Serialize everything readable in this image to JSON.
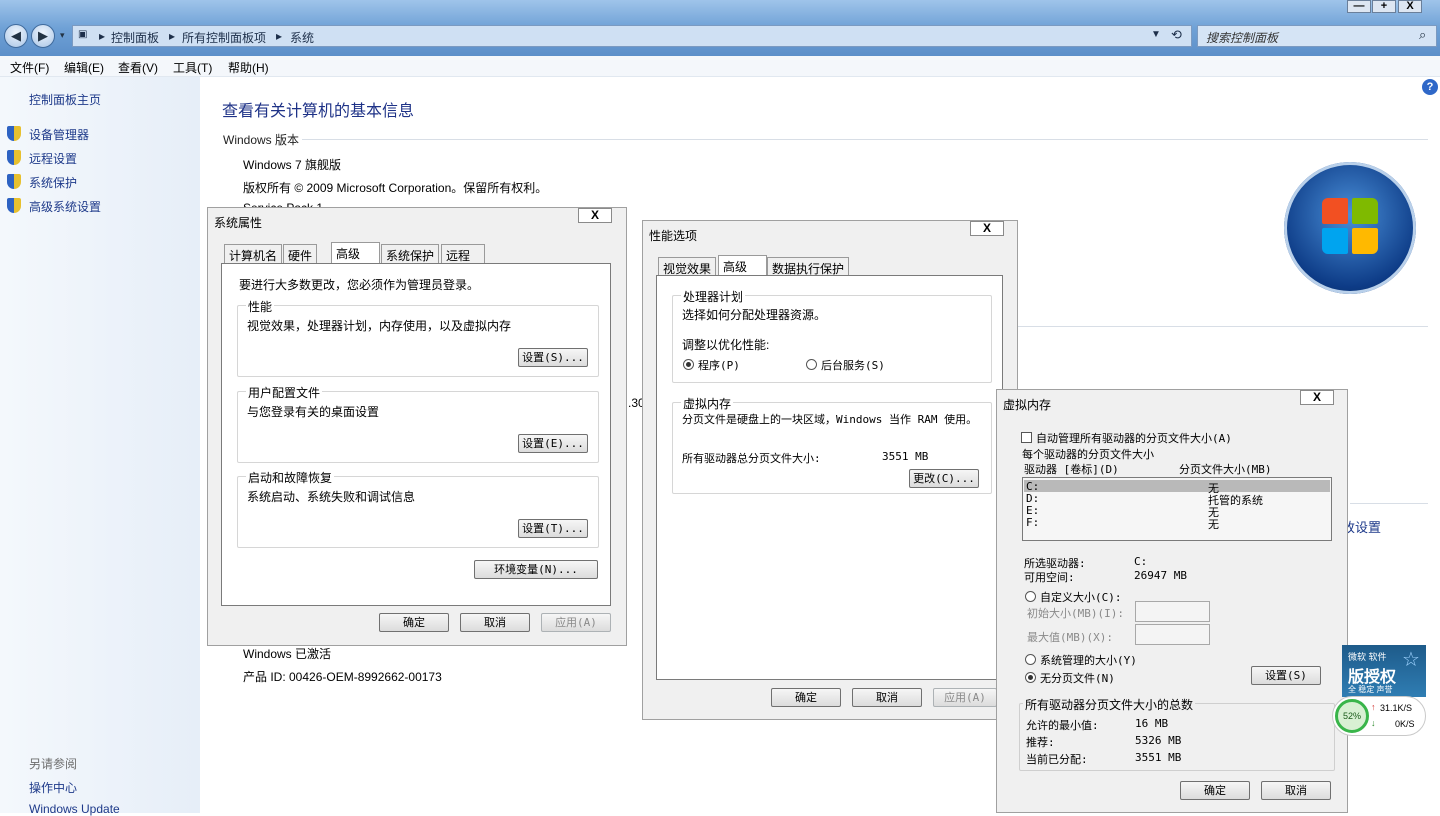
{
  "window": {
    "controls": [
      "—",
      "+",
      "X"
    ],
    "breadcrumb": [
      "控制面板",
      "所有控制面板项",
      "系统"
    ],
    "search_placeholder": "搜索控制面板"
  },
  "menu": [
    "文件(F)",
    "编辑(E)",
    "查看(V)",
    "工具(T)",
    "帮助(H)"
  ],
  "sidebar": {
    "home": "控制面板主页",
    "items": [
      "设备管理器",
      "远程设置",
      "系统保护",
      "高级系统设置"
    ],
    "see_also_label": "另请参阅",
    "see_also": [
      "操作中心",
      "Windows Update"
    ]
  },
  "main": {
    "heading": "查看有关计算机的基本信息",
    "edition_label": "Windows 版本",
    "edition": "Windows 7 旗舰版",
    "copyright": "版权所有 © 2009 Microsoft Corporation。保留所有权利。",
    "service_pack": "Service Pack 1",
    "activated": "Windows 已激活",
    "product_id": "产品 ID: 00426-OEM-8992662-00173",
    "partial_number": ".30",
    "partial_link": "改设置"
  },
  "sysprops": {
    "title": "系统属性",
    "close": "X",
    "tabs": [
      "计算机名",
      "硬件",
      "高级",
      "系统保护",
      "远程"
    ],
    "admin_note": "要进行大多数更改，您必须作为管理员登录。",
    "perf_label": "性能",
    "perf_desc": "视觉效果，处理器计划，内存使用，以及虚拟内存",
    "perf_btn": "设置(S)...",
    "profile_label": "用户配置文件",
    "profile_desc": "与您登录有关的桌面设置",
    "profile_btn": "设置(E)...",
    "startup_label": "启动和故障恢复",
    "startup_desc": "系统启动、系统失败和调试信息",
    "startup_btn": "设置(T)...",
    "env_btn": "环境变量(N)...",
    "ok": "确定",
    "cancel": "取消",
    "apply": "应用(A)"
  },
  "perfopts": {
    "title": "性能选项",
    "close": "X",
    "tabs": [
      "视觉效果",
      "高级",
      "数据执行保护"
    ],
    "cpu_label": "处理器计划",
    "cpu_desc": "选择如何分配处理器资源。",
    "optimize_label": "调整以优化性能:",
    "radio_programs": "程序(P)",
    "radio_services": "后台服务(S)",
    "vm_label": "虚拟内存",
    "vm_desc": "分页文件是硬盘上的一块区域，Windows 当作 RAM 使用。",
    "vm_total_label": "所有驱动器总分页文件大小:",
    "vm_total_value": "3551 MB",
    "change_btn": "更改(C)...",
    "ok": "确定",
    "cancel": "取消",
    "apply": "应用(A)"
  },
  "vmem": {
    "title": "虚拟内存",
    "close": "X",
    "auto_manage": "自动管理所有驱动器的分页文件大小(A)",
    "per_drive_label": "每个驱动器的分页文件大小",
    "col_drive": "驱动器 [卷标](D)",
    "col_size": "分页文件大小(MB)",
    "drives": [
      {
        "drive": "C:",
        "size": "无"
      },
      {
        "drive": "D:",
        "size": "托管的系统"
      },
      {
        "drive": "E:",
        "size": "无"
      },
      {
        "drive": "F:",
        "size": "无"
      }
    ],
    "selected_drive_label": "所选驱动器:",
    "selected_drive": "C:",
    "free_space_label": "可用空间:",
    "free_space": "26947 MB",
    "custom_size": "自定义大小(C):",
    "initial_size": "初始大小(MB)(I):",
    "max_size": "最大值(MB)(X):",
    "system_managed": "系统管理的大小(Y)",
    "no_paging": "无分页文件(N)",
    "set_btn": "设置(S)",
    "total_label": "所有驱动器分页文件大小的总数",
    "min_allowed_label": "允许的最小值:",
    "min_allowed": "16 MB",
    "recommended_label": "推荐:",
    "recommended": "5326 MB",
    "current_label": "当前已分配:",
    "current": "3551 MB",
    "ok": "确定",
    "cancel": "取消"
  },
  "tray": {
    "badge_top": "微软 软件",
    "badge_main": "版授权",
    "badge_bottom": "全 稳定 声誉",
    "cpu_percent": "52%",
    "up_speed": "31.1K/S",
    "down_speed": "0K/S"
  }
}
